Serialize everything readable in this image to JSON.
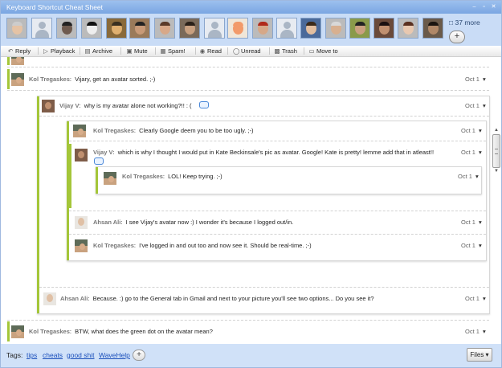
{
  "window": {
    "title": "Keyboard Shortcut Cheat Sheet",
    "controls": [
      "minimize-icon",
      "restore-icon",
      "close-icon"
    ]
  },
  "participants": {
    "count_shown": 19,
    "more_label": "37 more",
    "add_label": "+"
  },
  "toolbar": {
    "reply": "Reply",
    "playback": "Playback",
    "archive": "Archive",
    "mute": "Mute",
    "spam": "Spam!",
    "read": "Read",
    "unread": "Unread",
    "trash": "Trash",
    "move_to": "Move to",
    "icons": [
      "reply-icon",
      "playback-icon",
      "archive-icon",
      "mute-icon",
      "spam-icon",
      "read-icon",
      "unread-icon",
      "trash-icon",
      "folder-icon"
    ]
  },
  "blips": [
    {
      "author": "Kol Tregaskes",
      "text": "Vijary, get an avatar sorted. ;-)",
      "date": "Oct 1"
    },
    {
      "author": "Vijay V",
      "text": "why is my avatar alone not working?!! : (",
      "date": "Oct 1"
    },
    {
      "author": "Kol Tregaskes",
      "text": "Clearly Google deem you to be too ugly. ;-)",
      "date": "Oct 1"
    },
    {
      "author": "Vijay V",
      "text": "which is why I thought I would put in Kate Beckinsale's pic as avatar. Google! Kate is pretty! lemme add that in atleast!!",
      "date": "Oct 1"
    },
    {
      "author": "Kol Tregaskes",
      "text": "LOL! Keep trying. ;-)",
      "date": "Oct 1"
    },
    {
      "author": "Ahsan Ali",
      "text": "I see Vijay's avatar now :) I wonder it's because I logged out/in.",
      "date": "Oct 1"
    },
    {
      "author": "Kol Tregaskes",
      "text": "I've logged in and out too and now see it. Should be real-time. ;-)",
      "date": "Oct 1"
    },
    {
      "author": "Ahsan Ali",
      "text": "Because. :) go to the General tab in Gmail and next to your picture you'll see two options... Do you see it?",
      "date": "Oct 1"
    },
    {
      "author": "Kol Tregaskes",
      "text": "BTW, what does the green dot on the avatar mean?",
      "date": "Oct 1"
    }
  ],
  "footer": {
    "tags_label": "Tags:",
    "tags": [
      "tips",
      "cheats",
      "good shit",
      "WaveHelp"
    ],
    "add_tag": "+",
    "files": "Files"
  },
  "colors": {
    "accent": "#7aa6e2",
    "thread_bar": "#a4c639",
    "panel": "#c9dcf6",
    "footer": "#d0e1f8",
    "link": "#1a4fbb"
  }
}
